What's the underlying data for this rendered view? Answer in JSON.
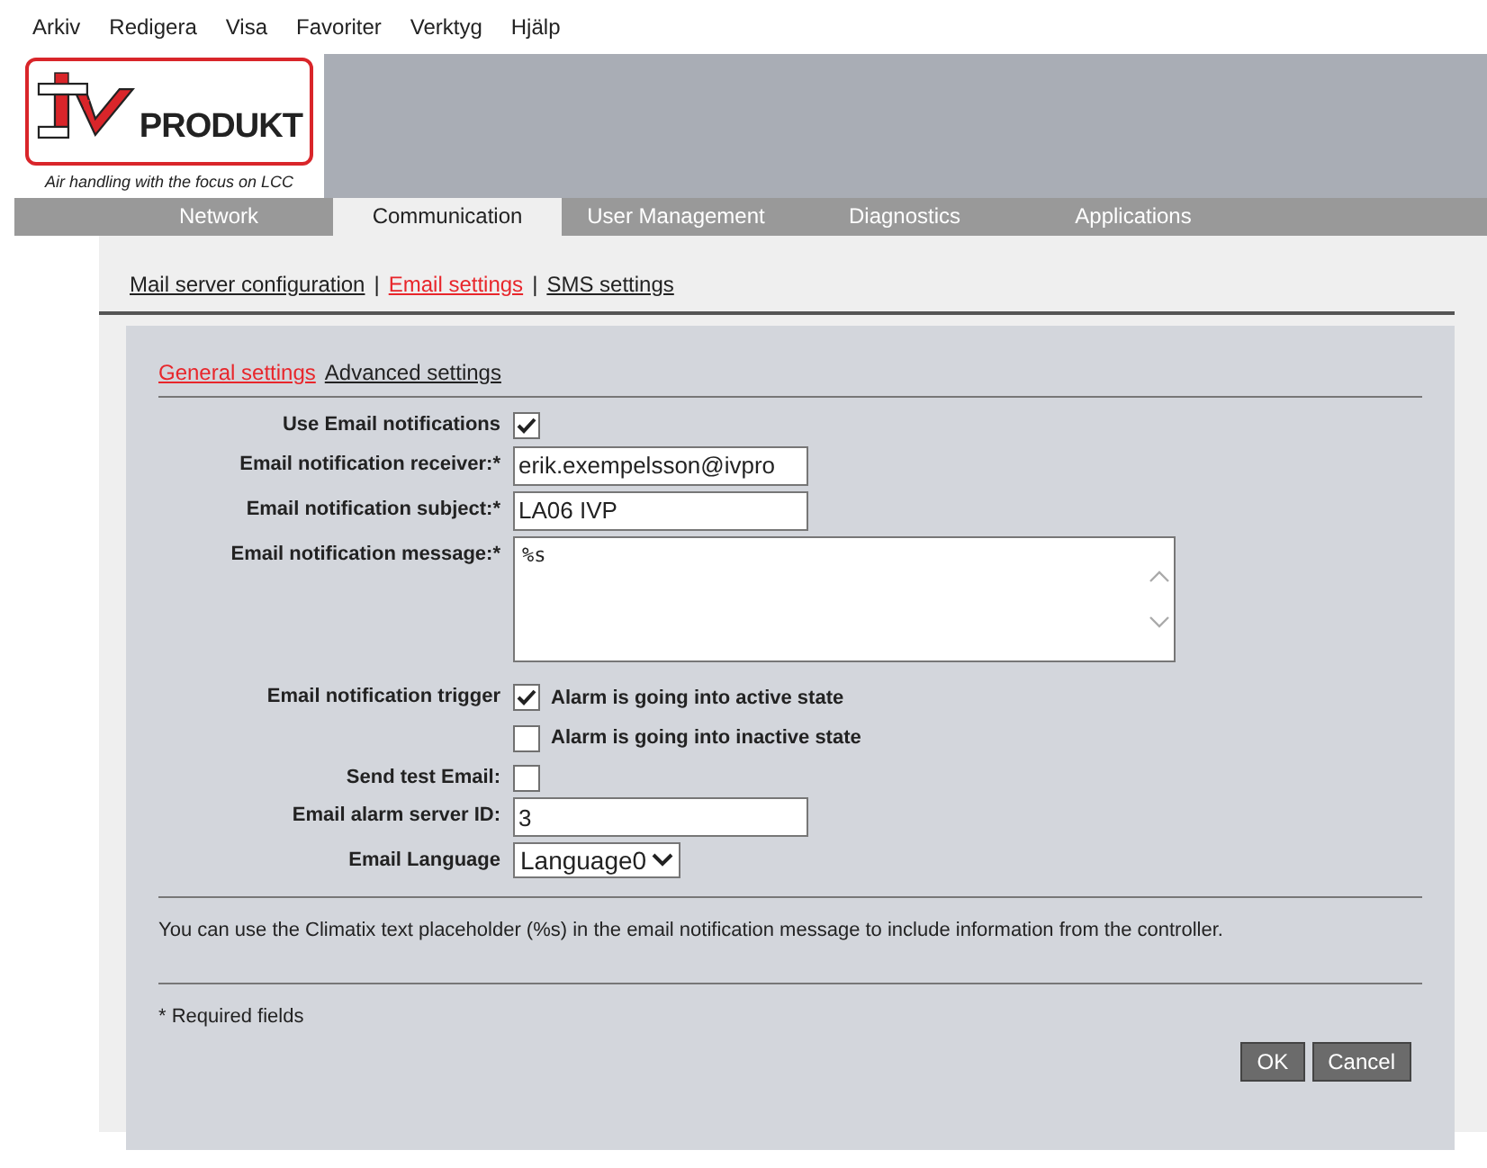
{
  "menu": [
    "Arkiv",
    "Redigera",
    "Visa",
    "Favoriter",
    "Verktyg",
    "Hjälp"
  ],
  "logo": {
    "brand": "PRODUKT",
    "tagline": "Air handling with the focus on LCC"
  },
  "tabs": [
    {
      "label": "Network",
      "selected": false
    },
    {
      "label": "Communication",
      "selected": true
    },
    {
      "label": "User Management",
      "selected": false
    },
    {
      "label": "Diagnostics",
      "selected": false
    },
    {
      "label": "Applications",
      "selected": false
    }
  ],
  "sub_links": [
    {
      "label": "Mail server configuration",
      "selected": false
    },
    {
      "label": "Email settings",
      "selected": true
    },
    {
      "label": "SMS settings",
      "selected": false
    }
  ],
  "sub_separator": "|",
  "section_tabs": [
    {
      "label": "General settings",
      "selected": true
    },
    {
      "label": "Advanced settings",
      "selected": false
    }
  ],
  "fields": [
    {
      "kind": "checkbox",
      "label": "Use Email notifications",
      "checked": true
    },
    {
      "kind": "text",
      "label": "Email notification receiver:*",
      "value": "erik.exempelsson@ivpro"
    },
    {
      "kind": "text",
      "label": "Email notification subject:*",
      "value": "LA06 IVP"
    },
    {
      "kind": "textarea",
      "label": "Email notification message:*",
      "value": "%s"
    },
    {
      "kind": "checks",
      "label": "Email notification trigger",
      "options": [
        {
          "label": "Alarm is going into active state",
          "checked": true
        },
        {
          "label": "Alarm is going into inactive state",
          "checked": false
        }
      ]
    },
    {
      "kind": "checkbox",
      "label": "Send test Email:",
      "checked": false
    },
    {
      "kind": "text",
      "label": "Email alarm server ID:",
      "value": "3"
    },
    {
      "kind": "select",
      "label": "Email Language",
      "value": "Language0"
    }
  ],
  "info": "You can use the Climatix text placeholder (%s) in the email notification message to include information from the controller.",
  "required_note": "* Required fields",
  "buttons": [
    "OK",
    "Cancel"
  ]
}
